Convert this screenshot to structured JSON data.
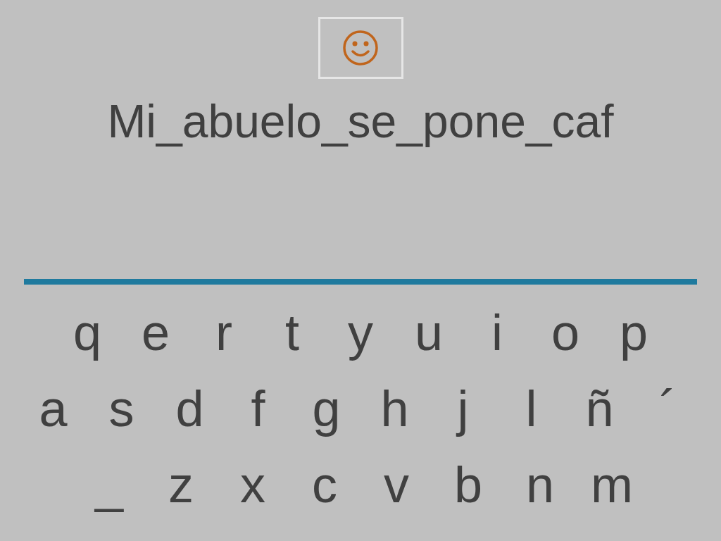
{
  "answer": "Mi_abuelo_se_pone_caf",
  "keyboard": {
    "rows": [
      [
        "q",
        "e",
        "r",
        "t",
        "y",
        "u",
        "i",
        "o",
        "p"
      ],
      [
        "a",
        "s",
        "d",
        "f",
        "g",
        "h",
        "j",
        "l",
        "ñ",
        "´"
      ],
      [
        "_",
        "z",
        "x",
        "c",
        "v",
        "b",
        "n",
        "m"
      ]
    ]
  }
}
